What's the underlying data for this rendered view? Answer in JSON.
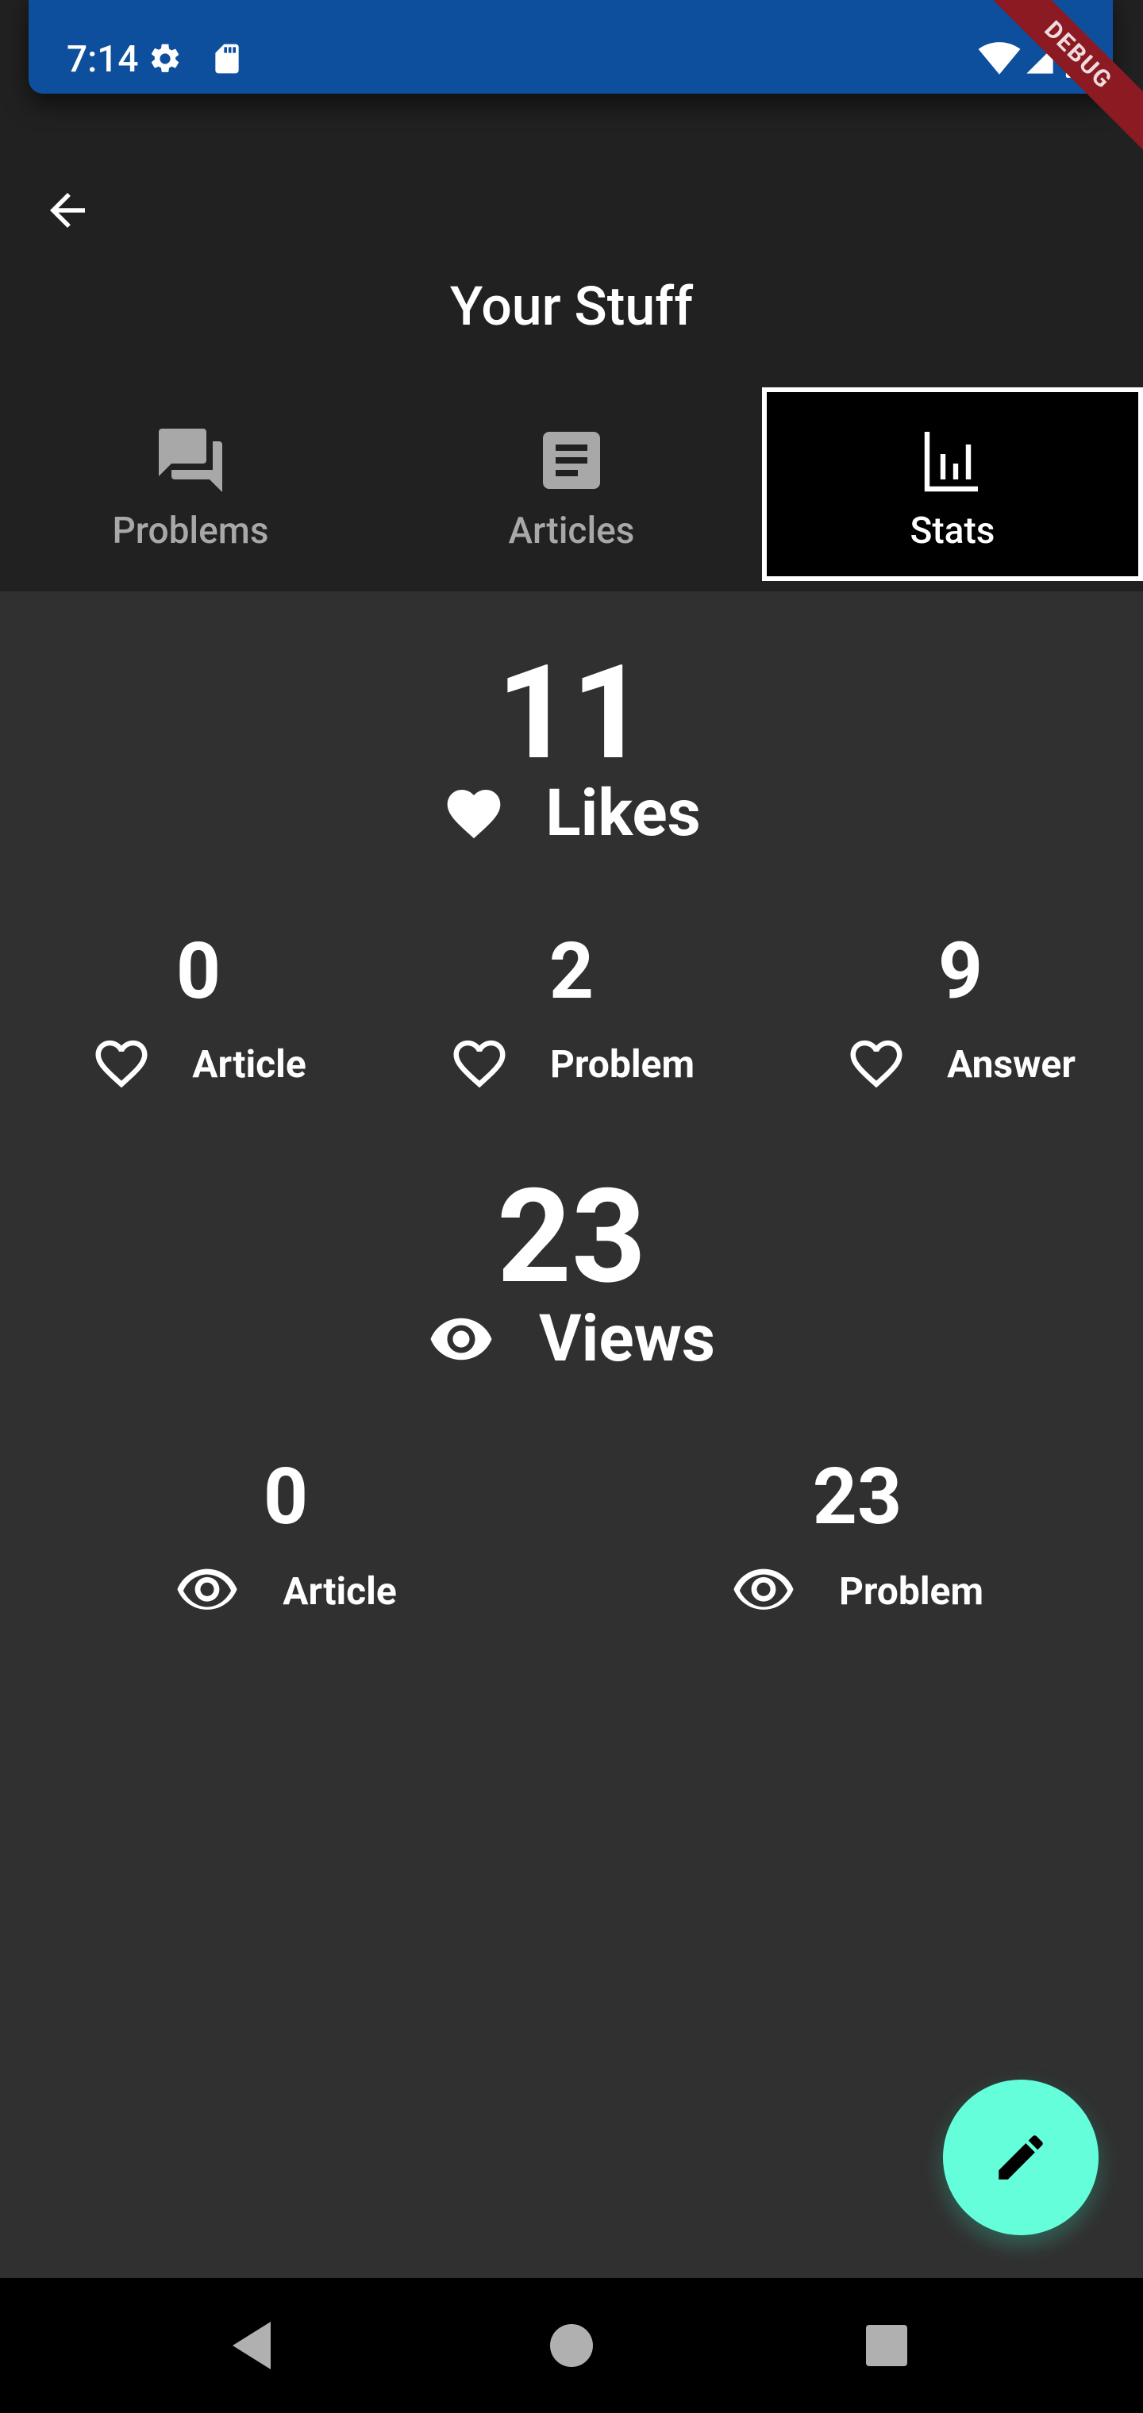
{
  "status_bar": {
    "time": "7:14",
    "debug_label": "DEBUG",
    "icons": [
      "settings-icon",
      "sd-card-icon",
      "wifi-icon",
      "signal-icon",
      "battery-icon"
    ]
  },
  "app_bar": {
    "title": "Your Stuff",
    "back_icon": "arrow-back-icon"
  },
  "tabs": [
    {
      "label": "Problems",
      "icon": "forum-icon",
      "selected": false
    },
    {
      "label": "Articles",
      "icon": "article-icon",
      "selected": false
    },
    {
      "label": "Stats",
      "icon": "bar-chart-icon",
      "selected": true
    }
  ],
  "stats": {
    "likes": {
      "total": "11",
      "label": "Likes",
      "breakdown": [
        {
          "value": "0",
          "label": "Article"
        },
        {
          "value": "2",
          "label": "Problem"
        },
        {
          "value": "9",
          "label": "Answer"
        }
      ]
    },
    "views": {
      "total": "23",
      "label": "Views",
      "breakdown": [
        {
          "value": "0",
          "label": "Article"
        },
        {
          "value": "23",
          "label": "Problem"
        }
      ]
    }
  },
  "fab": {
    "icon": "edit-icon",
    "color": "#64ffda"
  },
  "colors": {
    "status_bar": "#0d4f9c",
    "app_bar": "#212121",
    "background": "#303030",
    "accent": "#64ffda"
  }
}
